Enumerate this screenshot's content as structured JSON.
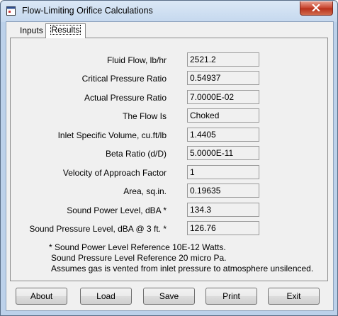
{
  "window": {
    "title": "Flow-Limiting Orifice Calculations"
  },
  "tabs": [
    {
      "label": "Inputs"
    },
    {
      "label": "Results"
    }
  ],
  "results": [
    {
      "label": "Fluid Flow, lb/hr",
      "value": "2521.2"
    },
    {
      "label": "Critical Pressure Ratio",
      "value": "0.54937"
    },
    {
      "label": "Actual Pressure Ratio",
      "value": "7.0000E-02"
    },
    {
      "label": "The Flow Is",
      "value": "Choked"
    },
    {
      "label": "Inlet Specific Volume, cu.ft/lb",
      "value": "1.4405"
    },
    {
      "label": "Beta Ratio (d/D)",
      "value": "5.0000E-11"
    },
    {
      "label": "Velocity of Approach Factor",
      "value": "1"
    },
    {
      "label": "Area, sq.in.",
      "value": "0.19635"
    },
    {
      "label": "Sound Power Level, dBA *",
      "value": "134.3"
    },
    {
      "label": "Sound Pressure Level, dBA @ 3 ft. *",
      "value": "126.76"
    }
  ],
  "notes": [
    "* Sound Power Level Reference 10E-12 Watts.",
    "Sound Pressure Level Reference 20 micro Pa.",
    "Assumes gas is vented from inlet pressure to atmosphere unsilenced."
  ],
  "buttons": {
    "about": "About",
    "load": "Load",
    "save": "Save",
    "print": "Print",
    "exit": "Exit"
  }
}
